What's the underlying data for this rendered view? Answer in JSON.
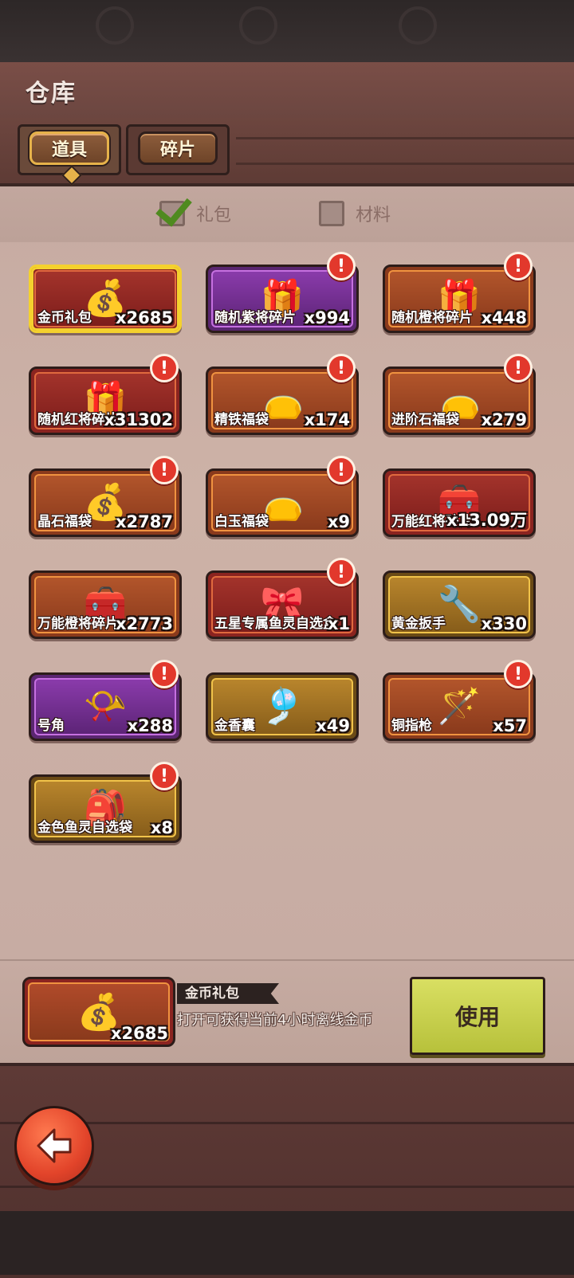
{
  "header": {
    "title": "仓库"
  },
  "tabs": [
    {
      "label": "道具",
      "active": true
    },
    {
      "label": "碎片",
      "active": false
    }
  ],
  "filters": [
    {
      "label": "礼包",
      "checked": true
    },
    {
      "label": "材料",
      "checked": false
    }
  ],
  "items": [
    {
      "name": "金币礼包",
      "qty": "x2685",
      "icon": "💰",
      "badge": "",
      "rarity": "red",
      "selected": true
    },
    {
      "name": "随机紫将碎片",
      "qty": "x994",
      "icon": "🎁",
      "badge": "!",
      "rarity": "purple"
    },
    {
      "name": "随机橙将碎片",
      "qty": "x448",
      "icon": "🎁",
      "badge": "!",
      "rarity": "orange"
    },
    {
      "name": "随机红将碎片",
      "qty": "x31302",
      "icon": "🎁",
      "badge": "!",
      "rarity": "red"
    },
    {
      "name": "精铁福袋",
      "qty": "x174",
      "icon": "👝",
      "badge": "!",
      "rarity": "orange"
    },
    {
      "name": "进阶石福袋",
      "qty": "x279",
      "icon": "👝",
      "badge": "!",
      "rarity": "orange"
    },
    {
      "name": "晶石福袋",
      "qty": "x2787",
      "icon": "💰",
      "badge": "!",
      "rarity": "orange"
    },
    {
      "name": "白玉福袋",
      "qty": "x9",
      "icon": "👝",
      "badge": "!",
      "rarity": "orange"
    },
    {
      "name": "万能红将碎片",
      "qty": "x13.09万",
      "icon": "🧰",
      "badge": "",
      "rarity": "red"
    },
    {
      "name": "万能橙将碎片",
      "qty": "x2773",
      "icon": "🧰",
      "badge": "",
      "rarity": "orange"
    },
    {
      "name": "五星专属鱼灵自选盒",
      "qty": "x1",
      "icon": "🎀",
      "badge": "!",
      "rarity": "red"
    },
    {
      "name": "黄金扳手",
      "qty": "x330",
      "icon": "🔧",
      "badge": "",
      "rarity": "gold"
    },
    {
      "name": "号角",
      "qty": "x288",
      "icon": "📯",
      "badge": "!",
      "rarity": "purple"
    },
    {
      "name": "金香囊",
      "qty": "x49",
      "icon": "🎐",
      "badge": "",
      "rarity": "gold"
    },
    {
      "name": "铜指枪",
      "qty": "x57",
      "icon": "🪄",
      "badge": "!",
      "rarity": "orange"
    },
    {
      "name": "金色鱼灵自选袋",
      "qty": "x8",
      "icon": "🎒",
      "badge": "!",
      "rarity": "gold"
    }
  ],
  "detail": {
    "name": "金币礼包",
    "qty": "x2685",
    "icon": "💰",
    "description": "打开可获得当前4小时离线金币",
    "use_label": "使用"
  },
  "icons": {
    "back": "back-arrow-icon",
    "check": "check-icon",
    "alert": "alert-badge-icon"
  },
  "colors": {
    "accent": "#f4d12e",
    "use_button": "#d1d85a",
    "back_button": "#e2442a"
  }
}
